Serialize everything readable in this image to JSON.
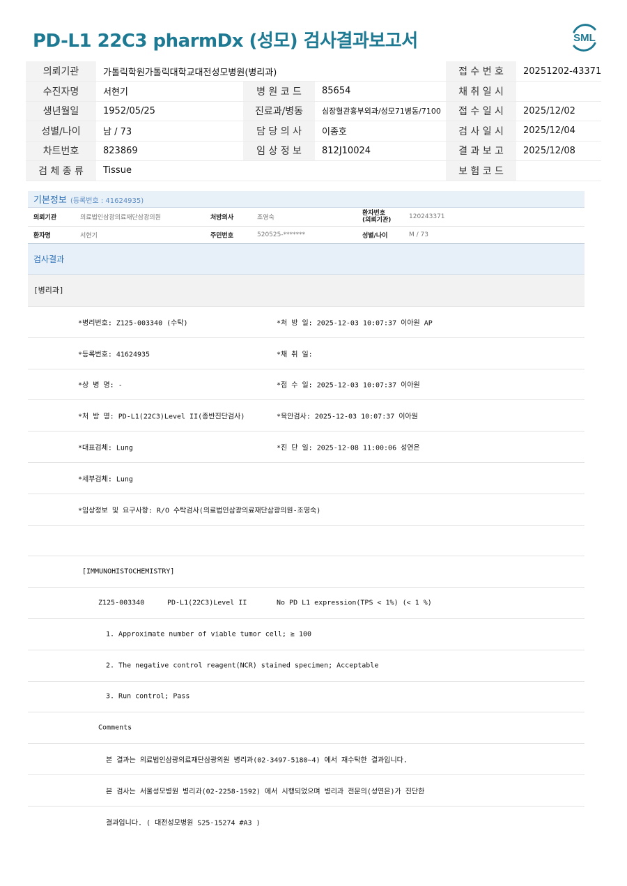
{
  "title": "PD-L1 22C3 pharmDx (성모) 검사결과보고서",
  "logo_text": "SML",
  "brand_color": "#1e7a93",
  "header": {
    "rows": [
      [
        {
          "l": "의뢰기관"
        },
        {
          "v": "가톨릭학원가톨릭대학교대전성모병원(병리과)"
        },
        {
          "l": "접 수 번 호"
        },
        {
          "v": "20251202-43371"
        }
      ],
      [
        {
          "l": "수진자명"
        },
        {
          "v": "서현기"
        },
        {
          "l": "병 원 코 드"
        },
        {
          "v": "85654"
        },
        {
          "l": "채 취 일 시"
        },
        {
          "v": ""
        }
      ],
      [
        {
          "l": "생년월일"
        },
        {
          "v": "1952/05/25"
        },
        {
          "l": "진료과/병동"
        },
        {
          "v": "심장혈관흉부외과/성모71병동/7100"
        },
        {
          "l": "접 수 일 시"
        },
        {
          "v": "2025/12/02"
        }
      ],
      [
        {
          "l": "성별/나이"
        },
        {
          "v": "남 / 73"
        },
        {
          "l": "담 당 의 사"
        },
        {
          "v": "이종호"
        },
        {
          "l": "검 사 일 시"
        },
        {
          "v": "2025/12/04"
        }
      ],
      [
        {
          "l": "차트번호"
        },
        {
          "v": "823869"
        },
        {
          "l": "임 상 정 보"
        },
        {
          "v": "812J10024"
        },
        {
          "l": "결 과 보 고"
        },
        {
          "v": "2025/12/08"
        }
      ],
      [
        {
          "l": "검 체 종 류"
        },
        {
          "v": "Tissue"
        },
        {
          "l": "보 험 코 드"
        },
        {
          "v": ""
        }
      ]
    ]
  },
  "basic_info": {
    "title": "기본정보",
    "reg_label": "(등록번호 : 41624935)",
    "row1": {
      "k1": "의뢰기관",
      "v1": "의료법인삼광의료재단삼광의원",
      "k2": "처방의사",
      "v2": "조영숙",
      "k3a": "환자번호",
      "k3b": "(의뢰기관)",
      "v3": "120243371"
    },
    "row2": {
      "k1": "환자명",
      "v1": "서현기",
      "k2": "주민번호",
      "v2": "520525-*******",
      "k3": "성별/나이",
      "v3": "M / 73"
    }
  },
  "result": {
    "title": "검사결과",
    "section": "[병리과]",
    "lines": [
      {
        "a": "*병리번호: Z125-003340 (수탁)",
        "b": "*처 방 일: 2025-12-03 10:07:37  이아원 AP"
      },
      {
        "a": "*등록번호: 41624935",
        "b": "*채 취 일:"
      },
      {
        "a": "*상 병 명: -",
        "b": "*접 수 일: 2025-12-03 10:07:37  이아원"
      },
      {
        "a": "*처 방 명: PD-L1(22C3)Level II(종반진단검사)",
        "b": "*육안검사: 2025-12-03 10:07:37  이아원"
      },
      {
        "a": "*대표검체: Lung",
        "b": "*진 단 일: 2025-12-08 11:00:06  성연은"
      },
      {
        "a": "*세부검체: Lung",
        "b": ""
      },
      {
        "a": "*임상정보 및 요구사항: R/O 수탁검사(의료법인삼광의료재단삼광의원-조영숙)",
        "b": ""
      },
      {
        "a": "",
        "b": ""
      }
    ],
    "ihc_heading": "[IMMUNOHISTOCHEMISTRY]",
    "ihc_result": {
      "id": "Z125-003340",
      "test": "PD-L1(22C3)Level II",
      "result": "No PD L1 expression(TPS < 1%) (< 1 %)"
    },
    "items": [
      "1. Approximate number of viable tumor cell; ≥ 100",
      "2. The negative control reagent(NCR) stained specimen; Acceptable",
      "3. Run control; Pass"
    ],
    "comments_label": "Comments",
    "comments": [
      "본 결과는 의료법인삼광의료재단삼광의원 병리과(02-3497-5180~4) 에서 재수탁한 결과입니다.",
      "본 검사는 서울성모병원 병리과(02-2258-1592) 에서 시행되었으며 병리과 전문의(성연은)가 진단한",
      "결과입니다. ( 대전성모병원 S25-15274 #A3 )"
    ]
  }
}
